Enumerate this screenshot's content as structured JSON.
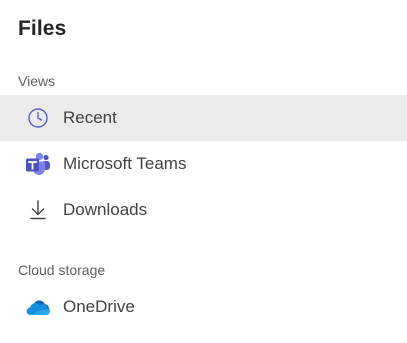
{
  "panel": {
    "title": "Files"
  },
  "sections": {
    "views": {
      "label": "Views",
      "items": [
        {
          "label": "Recent",
          "icon": "clock-icon",
          "selected": true
        },
        {
          "label": "Microsoft Teams",
          "icon": "microsoft-teams-icon",
          "selected": false
        },
        {
          "label": "Downloads",
          "icon": "download-icon",
          "selected": false
        }
      ]
    },
    "cloud": {
      "label": "Cloud storage",
      "items": [
        {
          "label": "OneDrive",
          "icon": "onedrive-icon",
          "selected": false
        }
      ]
    }
  },
  "colors": {
    "selected_background": "#ebebeb",
    "accent": "#6264a7",
    "onedrive_blue": "#0f78d4"
  }
}
